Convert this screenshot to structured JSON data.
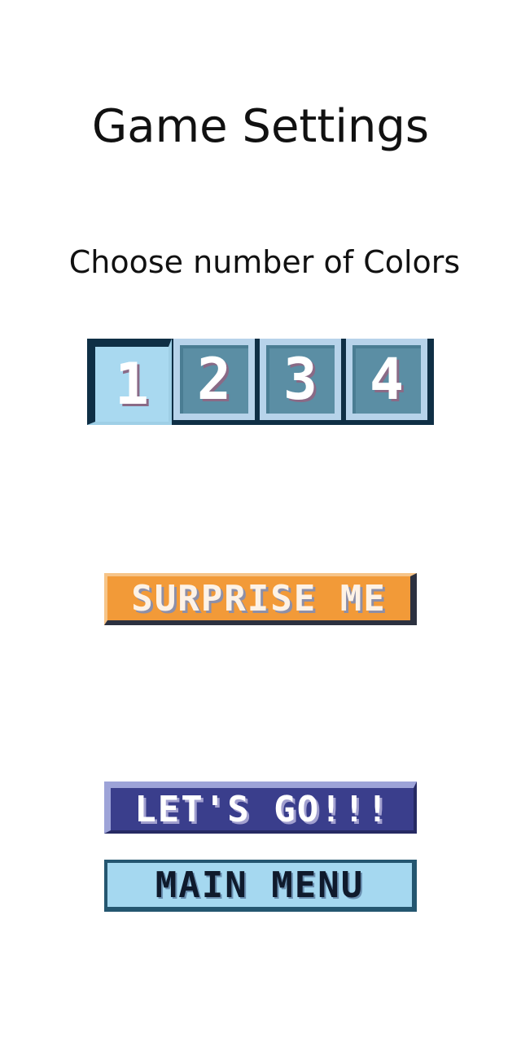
{
  "page": {
    "title": "Game Settings",
    "subtitle": "Choose number of Colors"
  },
  "color_options": {
    "selected": "1",
    "items": [
      {
        "label": "1",
        "selected": true
      },
      {
        "label": "2",
        "selected": false
      },
      {
        "label": "3",
        "selected": false
      },
      {
        "label": "4",
        "selected": false
      }
    ]
  },
  "buttons": {
    "surprise_label": "SURPRISE ME",
    "go_label": "LET'S GO!!!",
    "menu_label": "MAIN MENU"
  },
  "colors": {
    "selected_tile": "#a9d9f0",
    "unselected_tile": "#5b8ea4",
    "surprise_button": "#f29a38",
    "go_button": "#3a3e8c",
    "menu_button": "#a5d8f0"
  }
}
